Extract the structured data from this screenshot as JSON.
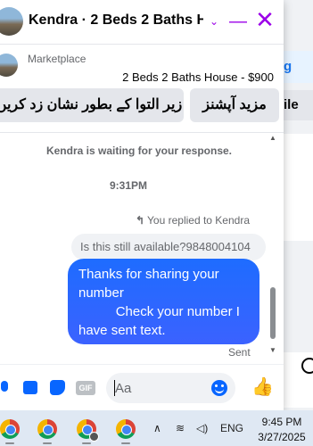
{
  "background": {
    "card_text": "g",
    "button_text": "ile"
  },
  "header": {
    "title": "Kendra · 2 Beds 2 Baths H...",
    "chevron": "⌄",
    "minimize": "—",
    "close": "✕"
  },
  "context": {
    "label": "Marketplace",
    "listing": "2 Beds 2 Baths House - $900"
  },
  "actions": {
    "mark": "زیر التوا کے بطور نشان زد کریں",
    "more": "مزید آپشنز"
  },
  "conversation": {
    "waiting_notice": "Kendra is waiting for your response.",
    "timestamp": "9:31PM",
    "replied_label": "You replied to Kendra",
    "replied_arrow": "↰",
    "quoted_message": "Is this still available?9848004104",
    "message": "Thanks for sharing your number\n          Check your number I have sent text.",
    "status": "Sent"
  },
  "scrollbar": {
    "up_arrow": "▲",
    "down_arrow": "▼"
  },
  "composer": {
    "placeholder": "Aa",
    "gif_label": "GIF",
    "like_icon": "👍"
  },
  "taskbar": {
    "chevron": "∧",
    "wifi": "≋",
    "volume": "◁)",
    "language": "ENG",
    "time": "9:45 PM",
    "date": "3/27/2025",
    "app_badge": "0"
  },
  "colors": {
    "accent": "#9b00e8",
    "messenger_blue": "#1877f2",
    "bubble": "#2f66ff"
  }
}
